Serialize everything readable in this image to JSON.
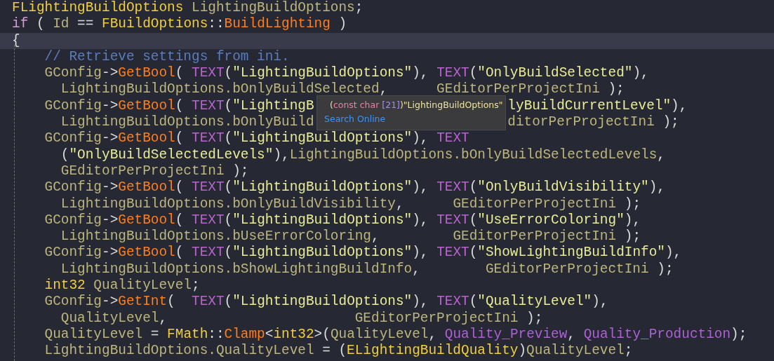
{
  "editor": {
    "lines": [
      {
        "current": false,
        "tokens": [
          {
            "kind": "type",
            "text": "FLightingBuildOptions"
          },
          {
            "kind": "plain",
            "text": " LightingBuildOptions"
          },
          {
            "kind": "punct",
            "text": ";"
          }
        ]
      },
      {
        "current": false,
        "tokens": [
          {
            "kind": "keyword",
            "text": "if"
          },
          {
            "kind": "punct",
            "text": " ( "
          },
          {
            "kind": "plain",
            "text": "Id"
          },
          {
            "kind": "punct",
            "text": " == "
          },
          {
            "kind": "type",
            "text": "FBuildOptions"
          },
          {
            "kind": "punct",
            "text": "::"
          },
          {
            "kind": "function",
            "text": "BuildLighting"
          },
          {
            "kind": "punct",
            "text": " )"
          }
        ]
      },
      {
        "current": true,
        "tokens": [
          {
            "kind": "punct",
            "text": "{"
          }
        ]
      },
      {
        "current": false,
        "tokens": [
          {
            "kind": "comment",
            "text": "    // Retrieve settings from ini."
          }
        ]
      },
      {
        "current": false,
        "tokens": [
          {
            "kind": "plain",
            "text": "    GConfig"
          },
          {
            "kind": "punct",
            "text": "->"
          },
          {
            "kind": "function",
            "text": "GetBool"
          },
          {
            "kind": "punct",
            "text": "( "
          },
          {
            "kind": "macro",
            "text": "TEXT"
          },
          {
            "kind": "punct",
            "text": "("
          },
          {
            "kind": "string",
            "text": "\"LightingBuildOptions\""
          },
          {
            "kind": "punct",
            "text": "), "
          },
          {
            "kind": "macro",
            "text": "TEXT"
          },
          {
            "kind": "punct",
            "text": "("
          },
          {
            "kind": "string",
            "text": "\"OnlyBuildSelected\""
          },
          {
            "kind": "punct",
            "text": "),"
          }
        ]
      },
      {
        "current": false,
        "tokens": [
          {
            "kind": "plain",
            "text": "      LightingBuildOptions.bOnlyBuildSelected"
          },
          {
            "kind": "punct",
            "text": ",      "
          },
          {
            "kind": "plain",
            "text": "GEditorPerProjectIni"
          },
          {
            "kind": "punct",
            "text": " );"
          }
        ]
      },
      {
        "current": false,
        "tokens": [
          {
            "kind": "plain",
            "text": "    GConfig"
          },
          {
            "kind": "punct",
            "text": "->"
          },
          {
            "kind": "function",
            "text": "GetBool"
          },
          {
            "kind": "punct",
            "text": "( "
          },
          {
            "kind": "macro",
            "text": "TEXT"
          },
          {
            "kind": "punct",
            "text": "("
          },
          {
            "kind": "string",
            "text": "\"LightingB"
          }
        ],
        "after": [
          {
            "kind": "string",
            "text": "lyBuildCurrentLevel\""
          },
          {
            "kind": "punct",
            "text": "),"
          }
        ]
      },
      {
        "current": false,
        "tokens": [
          {
            "kind": "plain",
            "text": "      LightingBuildOptions.bOnlyBuild"
          }
        ],
        "after": [
          {
            "kind": "plain",
            "text": "ditorPerProjectIni"
          },
          {
            "kind": "punct",
            "text": " );"
          }
        ]
      },
      {
        "current": false,
        "tokens": [
          {
            "kind": "plain",
            "text": "    GConfig"
          },
          {
            "kind": "punct",
            "text": "->"
          },
          {
            "kind": "function",
            "text": "GetBool"
          },
          {
            "kind": "punct",
            "text": "( "
          },
          {
            "kind": "macro",
            "text": "TEXT"
          },
          {
            "kind": "punct",
            "text": "("
          },
          {
            "kind": "string",
            "text": "\"LightingBuildOptions\""
          },
          {
            "kind": "punct",
            "text": "), "
          },
          {
            "kind": "macro",
            "text": "TEXT"
          }
        ]
      },
      {
        "current": false,
        "tokens": [
          {
            "kind": "punct",
            "text": "      ("
          },
          {
            "kind": "string",
            "text": "\"OnlyBuildSelectedLevels\""
          },
          {
            "kind": "punct",
            "text": "),"
          },
          {
            "kind": "plain",
            "text": "LightingBuildOptions.bOnlyBuildSelectedLevels"
          },
          {
            "kind": "punct",
            "text": ","
          }
        ]
      },
      {
        "current": false,
        "tokens": [
          {
            "kind": "plain",
            "text": "      GEditorPerProjectIni"
          },
          {
            "kind": "punct",
            "text": " );"
          }
        ]
      },
      {
        "current": false,
        "tokens": [
          {
            "kind": "plain",
            "text": "    GConfig"
          },
          {
            "kind": "punct",
            "text": "->"
          },
          {
            "kind": "function",
            "text": "GetBool"
          },
          {
            "kind": "punct",
            "text": "( "
          },
          {
            "kind": "macro",
            "text": "TEXT"
          },
          {
            "kind": "punct",
            "text": "("
          },
          {
            "kind": "string",
            "text": "\"LightingBuildOptions\""
          },
          {
            "kind": "punct",
            "text": "), "
          },
          {
            "kind": "macro",
            "text": "TEXT"
          },
          {
            "kind": "punct",
            "text": "("
          },
          {
            "kind": "string",
            "text": "\"OnlyBuildVisibility\""
          },
          {
            "kind": "punct",
            "text": "),"
          }
        ]
      },
      {
        "current": false,
        "tokens": [
          {
            "kind": "plain",
            "text": "      LightingBuildOptions.bOnlyBuildVisibility"
          },
          {
            "kind": "punct",
            "text": ",      "
          },
          {
            "kind": "plain",
            "text": "GEditorPerProjectIni"
          },
          {
            "kind": "punct",
            "text": " );"
          }
        ]
      },
      {
        "current": false,
        "tokens": [
          {
            "kind": "plain",
            "text": "    GConfig"
          },
          {
            "kind": "punct",
            "text": "->"
          },
          {
            "kind": "function",
            "text": "GetBool"
          },
          {
            "kind": "punct",
            "text": "( "
          },
          {
            "kind": "macro",
            "text": "TEXT"
          },
          {
            "kind": "punct",
            "text": "("
          },
          {
            "kind": "string",
            "text": "\"LightingBuildOptions\""
          },
          {
            "kind": "punct",
            "text": "), "
          },
          {
            "kind": "macro",
            "text": "TEXT"
          },
          {
            "kind": "punct",
            "text": "("
          },
          {
            "kind": "string",
            "text": "\"UseErrorColoring\""
          },
          {
            "kind": "punct",
            "text": "),"
          }
        ]
      },
      {
        "current": false,
        "tokens": [
          {
            "kind": "plain",
            "text": "      LightingBuildOptions.bUseErrorColoring"
          },
          {
            "kind": "punct",
            "text": ",         "
          },
          {
            "kind": "plain",
            "text": "GEditorPerProjectIni"
          },
          {
            "kind": "punct",
            "text": " );"
          }
        ]
      },
      {
        "current": false,
        "tokens": [
          {
            "kind": "plain",
            "text": "    GConfig"
          },
          {
            "kind": "punct",
            "text": "->"
          },
          {
            "kind": "function",
            "text": "GetBool"
          },
          {
            "kind": "punct",
            "text": "( "
          },
          {
            "kind": "macro",
            "text": "TEXT"
          },
          {
            "kind": "punct",
            "text": "("
          },
          {
            "kind": "string",
            "text": "\"LightingBuildOptions\""
          },
          {
            "kind": "punct",
            "text": "), "
          },
          {
            "kind": "macro",
            "text": "TEXT"
          },
          {
            "kind": "punct",
            "text": "("
          },
          {
            "kind": "string",
            "text": "\"ShowLightingBuildInfo\""
          },
          {
            "kind": "punct",
            "text": "),"
          }
        ]
      },
      {
        "current": false,
        "tokens": [
          {
            "kind": "plain",
            "text": "      LightingBuildOptions.bShowLightingBuildInfo"
          },
          {
            "kind": "punct",
            "text": ",        "
          },
          {
            "kind": "plain",
            "text": "GEditorPerProjectIni"
          },
          {
            "kind": "punct",
            "text": " );"
          }
        ]
      },
      {
        "current": false,
        "tokens": [
          {
            "kind": "type",
            "text": "    int32"
          },
          {
            "kind": "plain",
            "text": " QualityLevel"
          },
          {
            "kind": "punct",
            "text": ";"
          }
        ]
      },
      {
        "current": false,
        "tokens": [
          {
            "kind": "plain",
            "text": "    GConfig"
          },
          {
            "kind": "punct",
            "text": "->"
          },
          {
            "kind": "function",
            "text": "GetInt"
          },
          {
            "kind": "punct",
            "text": "(  "
          },
          {
            "kind": "macro",
            "text": "TEXT"
          },
          {
            "kind": "punct",
            "text": "("
          },
          {
            "kind": "string",
            "text": "\"LightingBuildOptions\""
          },
          {
            "kind": "punct",
            "text": "), "
          },
          {
            "kind": "macro",
            "text": "TEXT"
          },
          {
            "kind": "punct",
            "text": "("
          },
          {
            "kind": "string",
            "text": "\"QualityLevel\""
          },
          {
            "kind": "punct",
            "text": "),"
          }
        ]
      },
      {
        "current": false,
        "tokens": [
          {
            "kind": "plain",
            "text": "      QualityLevel"
          },
          {
            "kind": "punct",
            "text": ",                       "
          },
          {
            "kind": "plain",
            "text": "GEditorPerProjectIni"
          },
          {
            "kind": "punct",
            "text": " );"
          }
        ]
      },
      {
        "current": false,
        "tokens": [
          {
            "kind": "plain",
            "text": "    QualityLevel"
          },
          {
            "kind": "punct",
            "text": " = "
          },
          {
            "kind": "type",
            "text": "FMath"
          },
          {
            "kind": "punct",
            "text": "::"
          },
          {
            "kind": "function",
            "text": "Clamp"
          },
          {
            "kind": "punct",
            "text": "<"
          },
          {
            "kind": "type",
            "text": "int32"
          },
          {
            "kind": "punct",
            "text": ">("
          },
          {
            "kind": "plain",
            "text": "QualityLevel"
          },
          {
            "kind": "punct",
            "text": ", "
          },
          {
            "kind": "enum",
            "text": "Quality_Preview"
          },
          {
            "kind": "punct",
            "text": ", "
          },
          {
            "kind": "enum",
            "text": "Quality_Production"
          },
          {
            "kind": "punct",
            "text": ");"
          }
        ]
      },
      {
        "current": false,
        "tokens": [
          {
            "kind": "plain",
            "text": "    LightingBuildOptions.QualityLevel"
          },
          {
            "kind": "punct",
            "text": " = ("
          },
          {
            "kind": "type",
            "text": "ELightingBuildQuality"
          },
          {
            "kind": "punct",
            "text": ")"
          },
          {
            "kind": "plain",
            "text": "QualityLevel"
          },
          {
            "kind": "punct",
            "text": ";"
          }
        ]
      }
    ]
  },
  "tooltip": {
    "signature": [
      {
        "kind": "punct",
        "text": "("
      },
      {
        "kind": "keyword",
        "text": "const char "
      },
      {
        "kind": "size",
        "text": "[21]"
      },
      {
        "kind": "punct",
        "text": ")"
      },
      {
        "kind": "string",
        "text": "\"LightingBuildOptions\""
      }
    ],
    "link": "Search Online"
  }
}
